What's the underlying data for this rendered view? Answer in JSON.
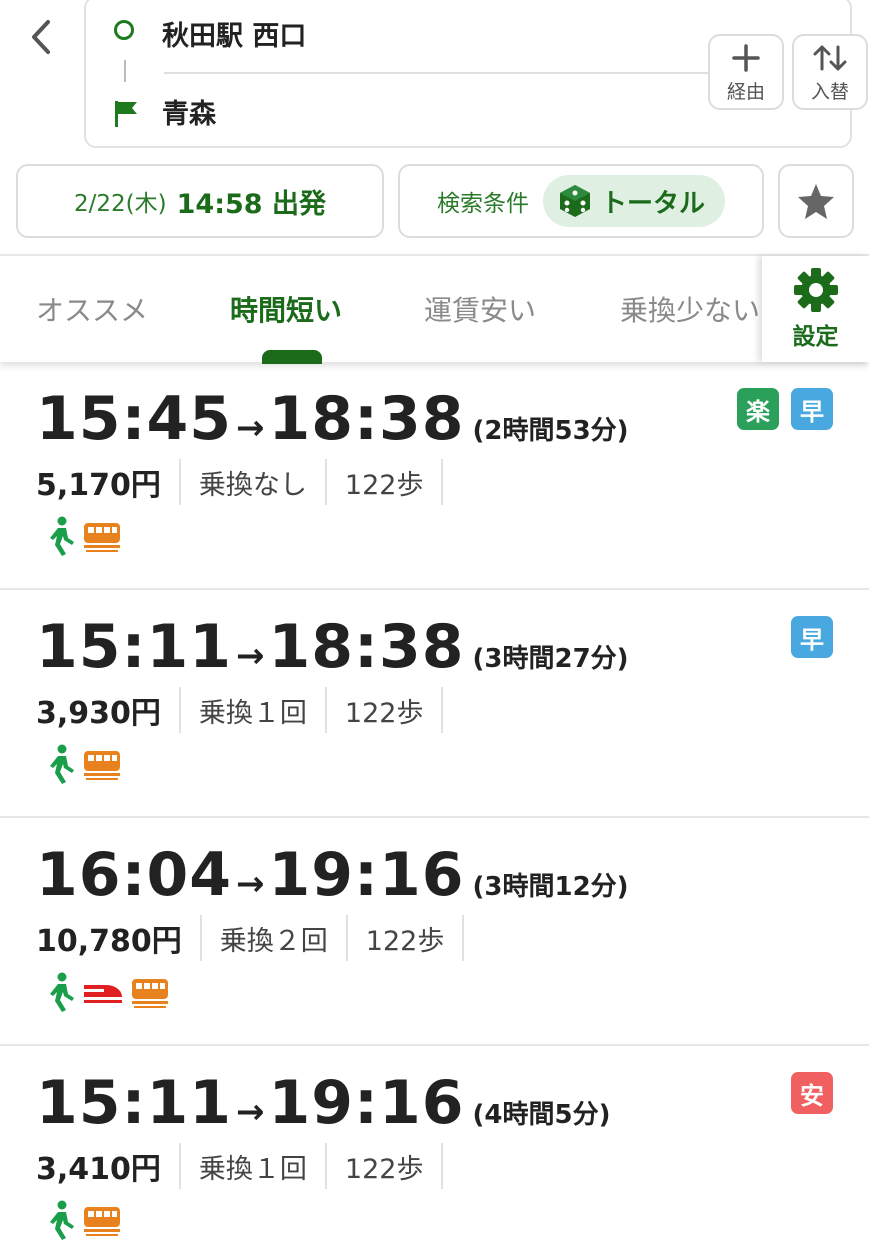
{
  "route": {
    "from": "秋田駅 西口",
    "to": "青森",
    "via_label": "経由",
    "swap_label": "入替"
  },
  "conditions": {
    "date": "2/22(木)",
    "time_label": "14:58 出発",
    "search_label": "検索条件",
    "mode_label": "トータル"
  },
  "tabs": [
    {
      "label": "オススメ"
    },
    {
      "label": "時間短い"
    },
    {
      "label": "運賃安い"
    },
    {
      "label": "乗換少ない"
    }
  ],
  "settings_label": "設定",
  "colors": {
    "accent": "#1b6b1b",
    "walk": "#1a9e4a",
    "train": "#e8821e",
    "shinkansen": "#e02020",
    "badge_raku": "#2aa05a",
    "badge_haya": "#4aa8e0",
    "badge_yasu": "#f06060"
  },
  "results": [
    {
      "depart": "15:45",
      "arrive": "18:38",
      "duration": "(2時間53分)",
      "fare": "5,170円",
      "transfers": "乗換なし",
      "steps": "122歩",
      "badges": [
        "楽",
        "早"
      ]
    },
    {
      "depart": "15:11",
      "arrive": "18:38",
      "duration": "(3時間27分)",
      "fare": "3,930円",
      "transfers": "乗換１回",
      "steps": "122歩",
      "badges": [
        "早"
      ]
    },
    {
      "depart": "16:04",
      "arrive": "19:16",
      "duration": "(3時間12分)",
      "fare": "10,780円",
      "transfers": "乗換２回",
      "steps": "122歩",
      "badges": []
    },
    {
      "depart": "15:11",
      "arrive": "19:16",
      "duration": "(4時間5分)",
      "fare": "3,410円",
      "transfers": "乗換１回",
      "steps": "122歩",
      "badges": [
        "安"
      ]
    }
  ]
}
